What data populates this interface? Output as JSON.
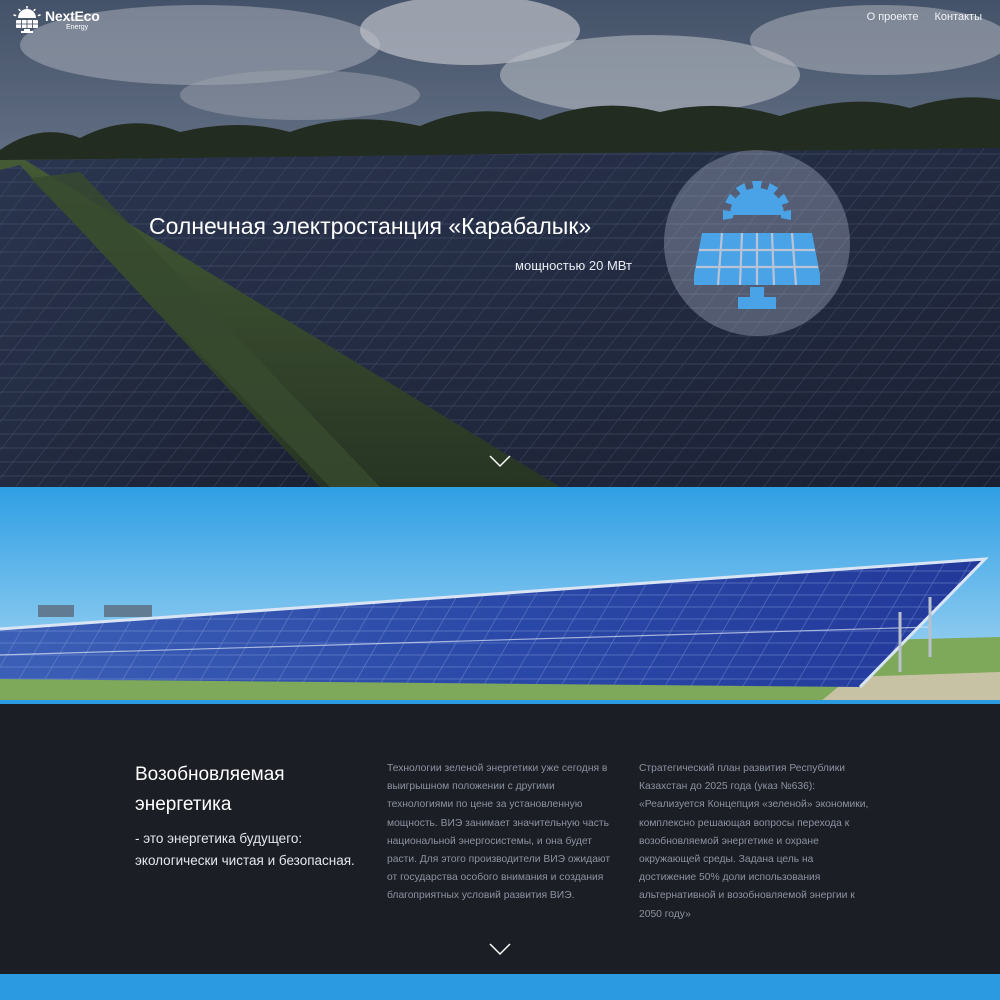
{
  "header": {
    "logo_name": "NextEco",
    "logo_sub": "Energy",
    "nav": [
      {
        "label": "О проекте"
      },
      {
        "label": "Контакты"
      }
    ]
  },
  "hero": {
    "title": "Солнечная электростанция «Карабалык»",
    "subtitle": "мощностью 20 МВт",
    "badge_icon": "solar-panel-sun-icon",
    "scroll_icon": "chevron-down-icon"
  },
  "info": {
    "heading": "Возобновляемая энергетика",
    "lead": "- это энергетика будущего: экологически чистая и безопасная.",
    "column1": "Технологии зеленой энергетики уже сегодня в выигрышном положении с другими технологиями по цене за установленную мощность. ВИЭ занимает значительную часть национальной энергосистемы, и она будет расти. Для этого производители ВИЭ ожидают от государства особого внимания и создания благоприятных условий развития ВИЭ.",
    "column2": "Стратегический план развития Республики Казахстан до 2025 года (указ №636): «Реализуется Концепция «зеленой» экономики, комплексно решающая вопросы перехода к возобновляемой энергетике и охране окружающей среды. Задана цель на достижение 50% доли использования альтернативной и возобновляемой энергии к 2050 году»",
    "scroll_icon": "chevron-down-icon"
  },
  "colors": {
    "accent": "#2c9ae0",
    "dark_bg": "#1b1e25",
    "badge_icon": "#4aa3e6"
  }
}
